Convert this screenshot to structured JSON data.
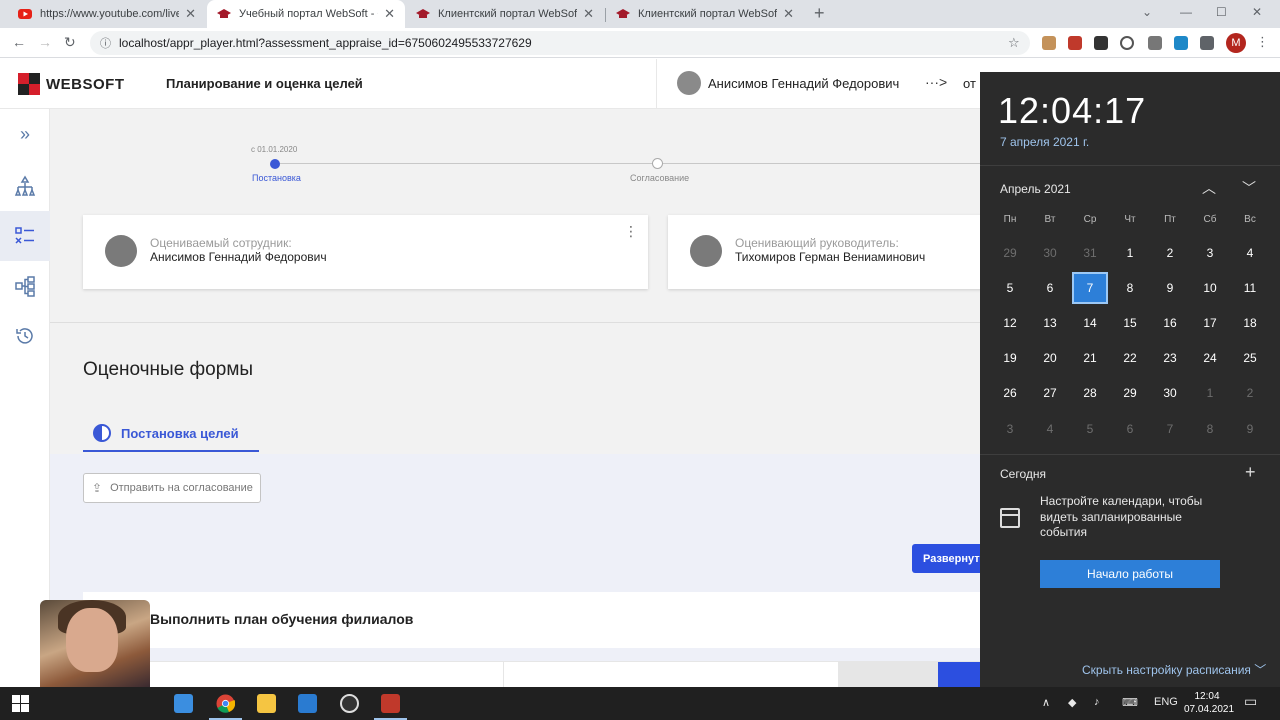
{
  "browser": {
    "tabs": [
      {
        "title": "https://www.youtube.com/live_c",
        "favicon_color": "#e62117"
      },
      {
        "title": "Учебный портал WebSoft - Оце",
        "favicon_color": "#a31a2a"
      },
      {
        "title": "Клиентский портал WebSoft",
        "favicon_color": "#a31a2a"
      },
      {
        "title": "Клиентский портал WebSoft",
        "favicon_color": "#a31a2a"
      }
    ],
    "url": "localhost/appr_player.html?assessment_appraise_id=6750602495533727629",
    "profile_initial": "M"
  },
  "app": {
    "logo_text": "WEBSOFT",
    "title": "Планирование и оценка целей",
    "user_name": "Анисимов Геннадий Федорович",
    "arrow": "···>",
    "from_label": "от"
  },
  "timeline": {
    "date": "с 01.01.2020",
    "stage1": "Постановка",
    "stage2": "Согласование"
  },
  "cards": {
    "employee_label": "Оцениваемый сотрудник:",
    "employee_name": "Анисимов Геннадий Федорович",
    "manager_label": "Оценивающий руководитель:",
    "manager_name": "Тихомиров Герман Вениаминович"
  },
  "forms": {
    "heading": "Оценочные формы",
    "tab_label": "Постановка целей",
    "send_button": "Отправить на согласование",
    "expand_button": "Развернуть",
    "goal_title": "Выполнить план обучения филиалов"
  },
  "calendar": {
    "time": "12:04:17",
    "date_full": "7 апреля 2021 г.",
    "month_label": "Апрель 2021",
    "weekdays": [
      "Пн",
      "Вт",
      "Ср",
      "Чт",
      "Пт",
      "Сб",
      "Вс"
    ],
    "weeks": [
      [
        "29",
        "30",
        "31",
        "1",
        "2",
        "3",
        "4"
      ],
      [
        "5",
        "6",
        "7",
        "8",
        "9",
        "10",
        "11"
      ],
      [
        "12",
        "13",
        "14",
        "15",
        "16",
        "17",
        "18"
      ],
      [
        "19",
        "20",
        "21",
        "22",
        "23",
        "24",
        "25"
      ],
      [
        "26",
        "27",
        "28",
        "29",
        "30",
        "1",
        "2"
      ],
      [
        "3",
        "4",
        "5",
        "6",
        "7",
        "8",
        "9"
      ]
    ],
    "today_label": "Сегодня",
    "setup_message": "Настройте календари, чтобы видеть запланированные события",
    "start_button": "Начало работы",
    "hide_schedule": "Скрыть настройку расписания"
  },
  "taskbar": {
    "language": "ENG",
    "time": "12:04",
    "date": "07.04.2021"
  },
  "colors": {
    "accent": "#3a58d6",
    "button_blue": "#2c4fe0",
    "flyout_bg": "#2b2b2b",
    "flyout_accent": "#2d7fd8"
  }
}
